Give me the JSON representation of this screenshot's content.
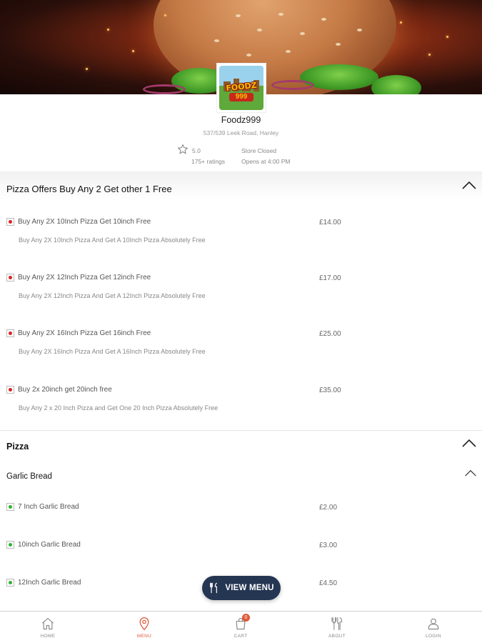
{
  "store": {
    "name": "Foodz999",
    "address": "537/539 Leek Road, Hanley",
    "rating": "5.0",
    "ratings_count": "175+ ratings",
    "status": "Store Closed",
    "opens": "Opens at 4:00 PM",
    "logo_text": "FOODZ",
    "logo_number": "999"
  },
  "sections": [
    {
      "title": "Pizza Offers Buy Any 2 Get other 1 Free",
      "items": [
        {
          "name": "Buy Any 2X 10Inch Pizza Get 10inch Free",
          "desc": "Buy Any 2X 10Inch Pizza And Get A 10Inch Pizza Absolutely Free",
          "price": "£14.00",
          "type": "non-veg"
        },
        {
          "name": "Buy Any 2X 12Inch Pizza Get 12inch Free",
          "desc": "Buy Any 2X 12Inch Pizza And Get A 12Inch Pizza Absolutely Free",
          "price": "£17.00",
          "type": "non-veg"
        },
        {
          "name": "Buy Any 2X 16Inch Pizza Get 16inch Free",
          "desc": "Buy Any 2X 16Inch Pizza And Get A 16Inch Pizza Absolutely Free",
          "price": "£25.00",
          "type": "non-veg"
        },
        {
          "name": "Buy 2x 20inch get 20inch free",
          "desc": "Buy Any 2 x 20 Inch Pizza and Get One 20 Inch Pizza Absolutely Free",
          "price": "£35.00",
          "type": "non-veg"
        }
      ]
    },
    {
      "title": "Pizza",
      "subsection": "Garlic Bread",
      "items": [
        {
          "name": "7 Inch Garlic Bread",
          "price": "£2.00",
          "type": "veg"
        },
        {
          "name": "10inch Garlic Bread",
          "price": "£3.00",
          "type": "veg"
        },
        {
          "name": "12Inch Garlic Bread",
          "price": "£4.50",
          "type": "veg"
        }
      ]
    }
  ],
  "view_menu_label": "VIEW MENU",
  "nav": {
    "items": [
      {
        "label": "HOME",
        "icon": "home-icon"
      },
      {
        "label": "MENU",
        "icon": "location-pin-icon",
        "active": true
      },
      {
        "label": "CART",
        "icon": "cart-icon",
        "badge": "0"
      },
      {
        "label": "ABOUT",
        "icon": "cutlery-icon"
      },
      {
        "label": "LOGIN",
        "icon": "user-icon"
      }
    ]
  },
  "colors": {
    "accent": "#e05a3a",
    "button": "#253652",
    "non_veg": "#e02020",
    "veg": "#2db52d"
  }
}
